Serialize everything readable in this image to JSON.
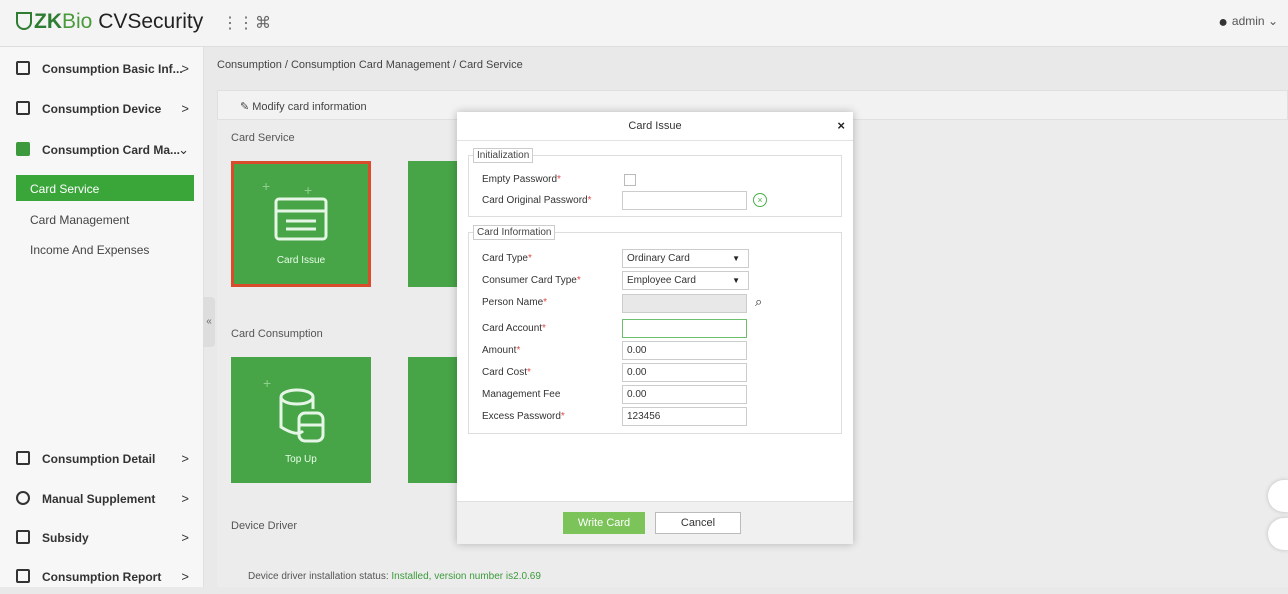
{
  "app": {
    "logo_u": "U",
    "logo_zk": "ZK",
    "logo_bio": "Bio",
    "logo_rest": " CVSecurity",
    "user": "admin",
    "user_caret": "⌄"
  },
  "icons": {
    "grid": "grid-icon",
    "command": "command-icon",
    "user": "user-circle-icon"
  },
  "sidebar": {
    "items": [
      {
        "label": "Consumption Basic Inf...",
        "chev": ">"
      },
      {
        "label": "Consumption Device",
        "chev": ">"
      },
      {
        "label": "Consumption Card Ma...",
        "chev": "⌄"
      },
      {
        "label": "Consumption Detail",
        "chev": ">"
      },
      {
        "label": "Manual Supplement",
        "chev": ">"
      },
      {
        "label": "Subsidy",
        "chev": ">"
      },
      {
        "label": "Consumption Report",
        "chev": ">"
      }
    ],
    "subitems": [
      "Card Service",
      "Card Management",
      "Income And Expenses"
    ],
    "collapse": "«"
  },
  "breadcrumb": "Consumption / Consumption Card Management / Card Service",
  "modify_bar": "✎ Modify card information",
  "sections": {
    "service": "Card Service",
    "consumption": "Card Consumption",
    "driver": "Device Driver"
  },
  "tiles": {
    "issue": "Card Issue",
    "topup": "Top Up"
  },
  "driver_status": {
    "label": "Device driver installation status:",
    "value": "Installed, version number is2.0.69"
  },
  "dialog": {
    "title": "Card Issue",
    "close": "×",
    "init_legend": "Initialization",
    "empty_password": "Empty Password",
    "original_password": "Card Original Password",
    "info_legend": "Card Information",
    "fields": {
      "card_type": {
        "label": "Card Type",
        "value": "Ordinary Card"
      },
      "consumer_card_type": {
        "label": "Consumer Card Type",
        "value": "Employee Card"
      },
      "person_name": {
        "label": "Person Name",
        "value": ""
      },
      "card_account": {
        "label": "Card Account",
        "value": ""
      },
      "amount": {
        "label": "Amount",
        "value": "0.00"
      },
      "card_cost": {
        "label": "Card Cost",
        "value": "0.00"
      },
      "management_fee": {
        "label": "Management Fee",
        "value": "0.00"
      },
      "excess_password": {
        "label": "Excess Password",
        "value": "123456"
      }
    },
    "write_card": "Write Card",
    "cancel": "Cancel"
  },
  "colors": {
    "accent": "#3aa63a",
    "tile": "#47a447",
    "required": "#e04a4a",
    "selected_border": "#d94c2b"
  }
}
